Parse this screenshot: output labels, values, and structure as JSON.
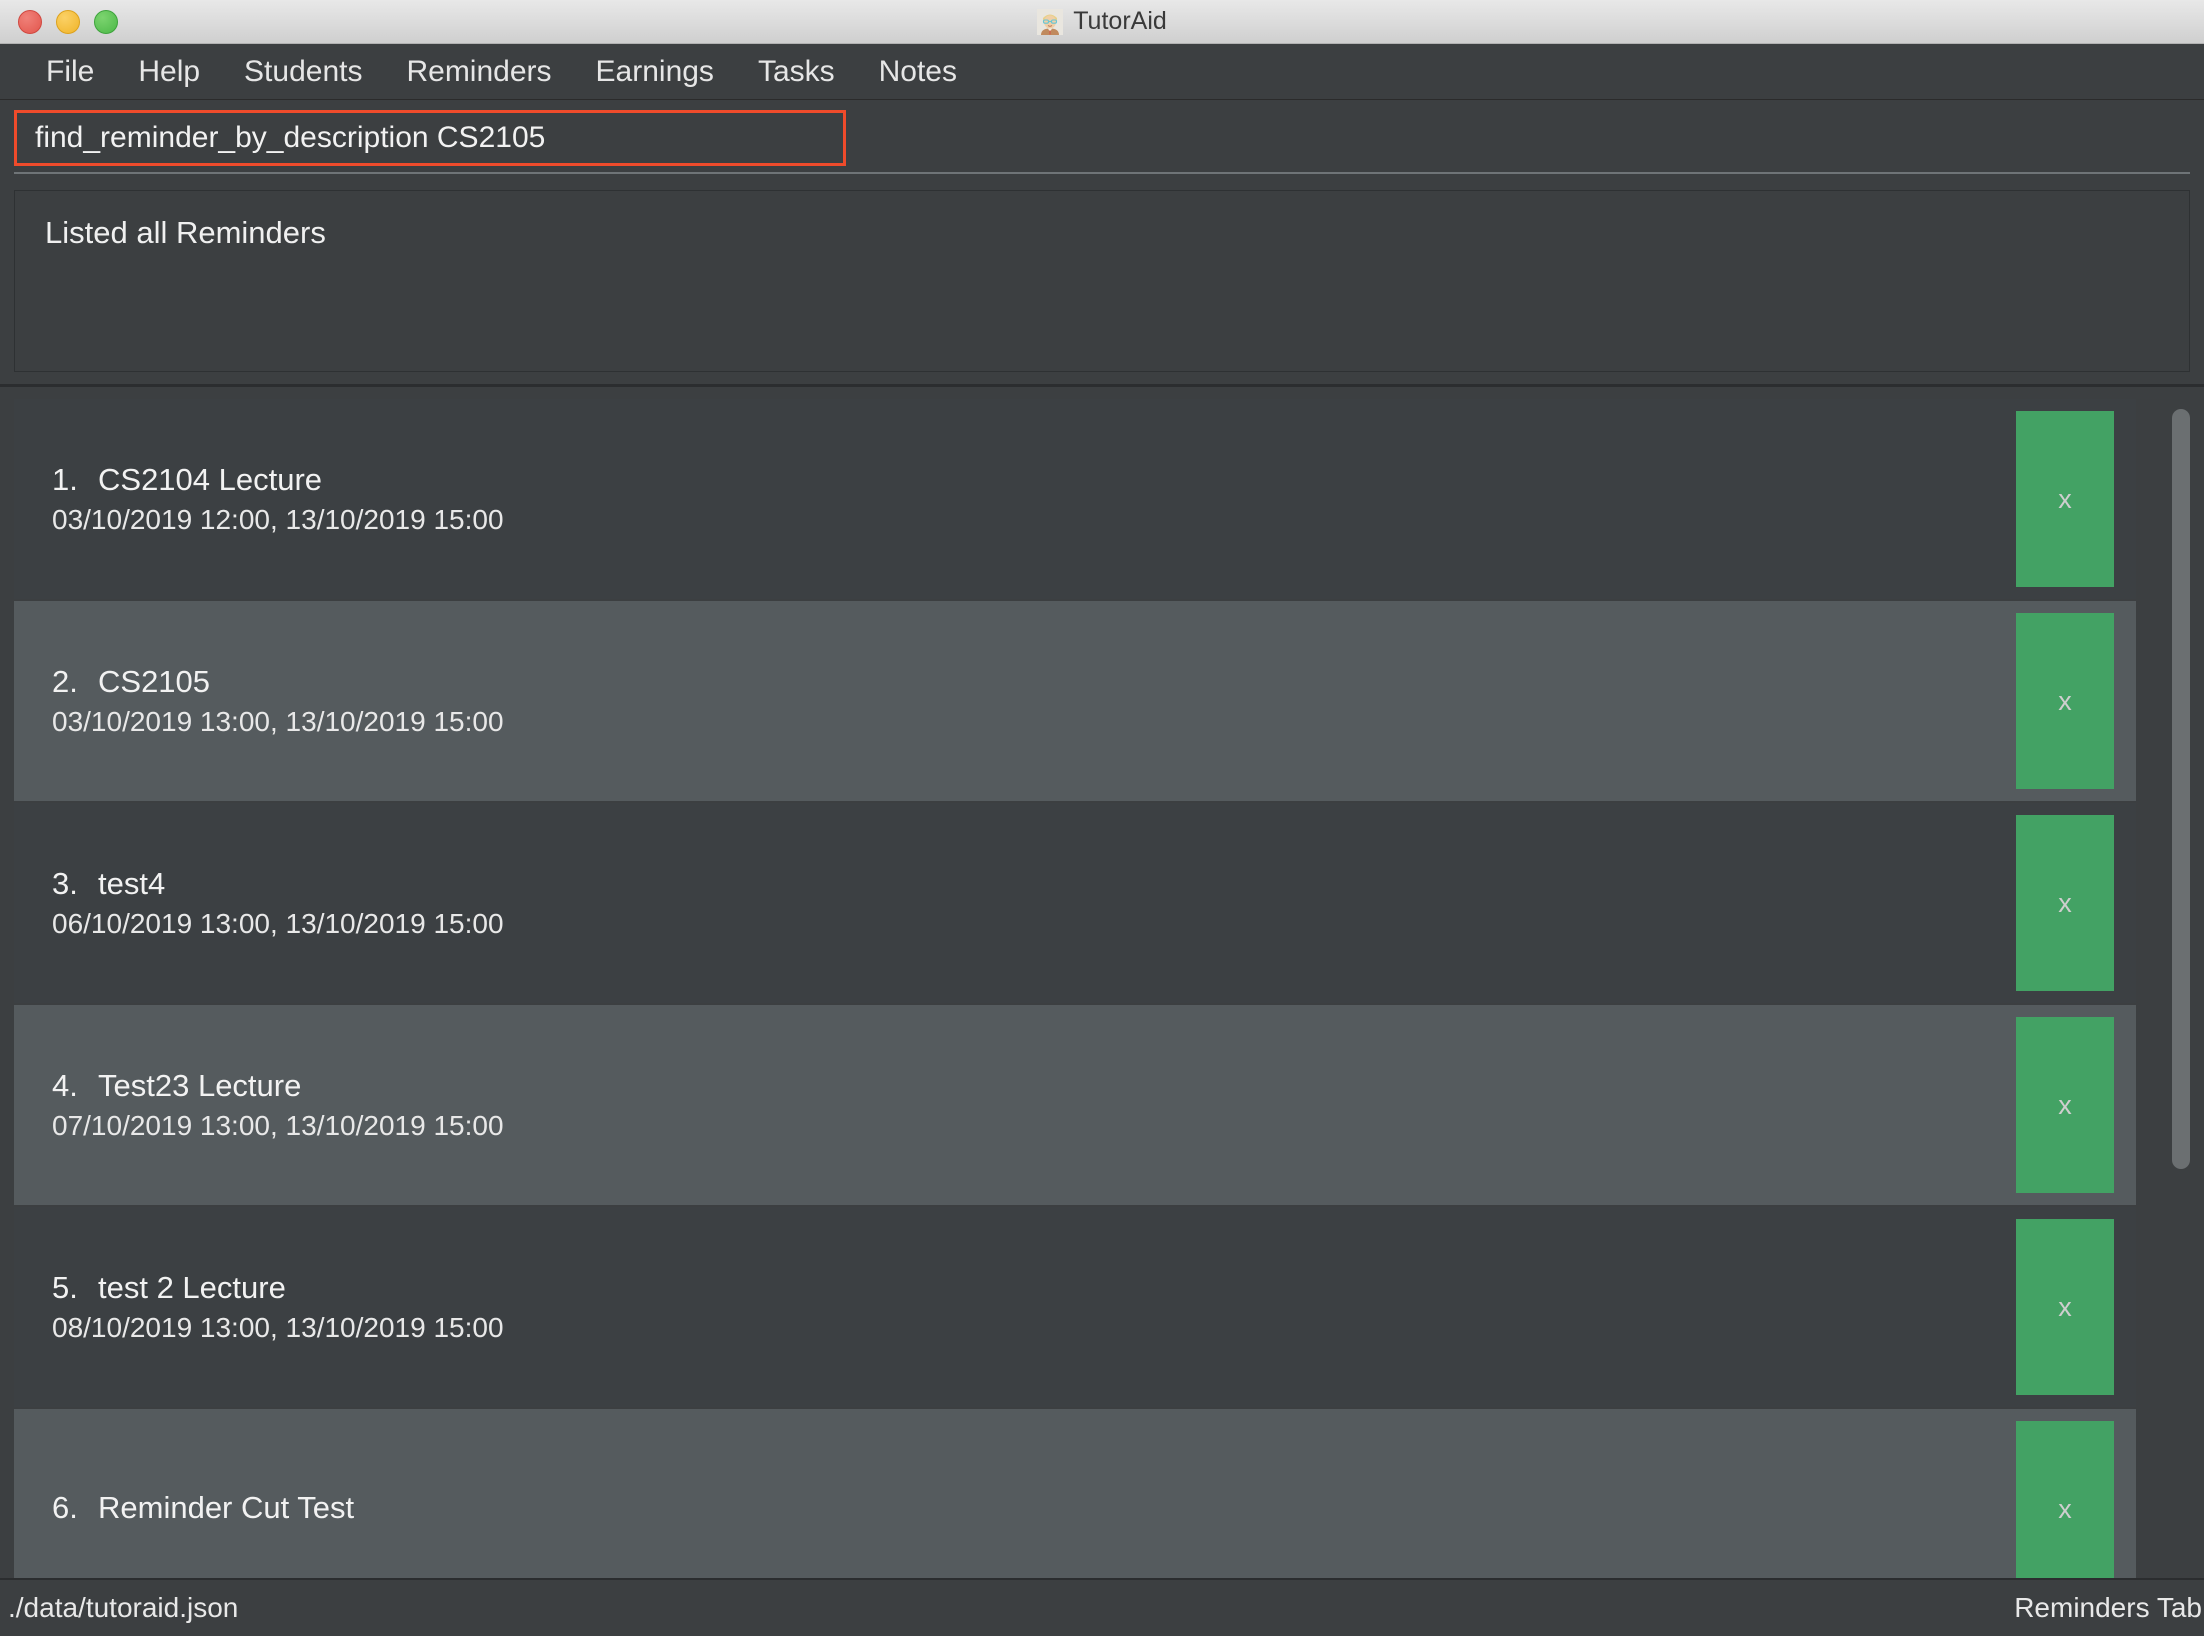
{
  "window": {
    "title": "TutorAid",
    "app_icon": "tutor-avatar-icon",
    "traffic_lights": [
      {
        "name": "close",
        "color": "#e2564d"
      },
      {
        "name": "minimize",
        "color": "#f0b429"
      },
      {
        "name": "zoom",
        "color": "#4cb848"
      }
    ]
  },
  "menubar": {
    "items": [
      {
        "label": "File"
      },
      {
        "label": "Help"
      },
      {
        "label": "Students"
      },
      {
        "label": "Reminders"
      },
      {
        "label": "Earnings"
      },
      {
        "label": "Tasks"
      },
      {
        "label": "Notes"
      }
    ]
  },
  "command": {
    "value": "find_reminder_by_description CS2105",
    "placeholder": "Enter command here...",
    "highlight_color": "#ef4b2b"
  },
  "result": {
    "text": "Listed all Reminders"
  },
  "list": {
    "delete_button_label": "x",
    "delete_button_color": "#43a264",
    "items": [
      {
        "index": "1.",
        "title": "CS2104 Lecture",
        "datetime": "03/10/2019 12:00, 13/10/2019 15:00"
      },
      {
        "index": "2.",
        "title": "CS2105",
        "datetime": "03/10/2019 13:00, 13/10/2019 15:00"
      },
      {
        "index": "3.",
        "title": "test4",
        "datetime": "06/10/2019 13:00, 13/10/2019 15:00"
      },
      {
        "index": "4.",
        "title": "Test23 Lecture",
        "datetime": "07/10/2019 13:00, 13/10/2019 15:00"
      },
      {
        "index": "5.",
        "title": "test 2 Lecture",
        "datetime": "08/10/2019 13:00, 13/10/2019 15:00"
      },
      {
        "index": "6.",
        "title": "Reminder Cut Test",
        "datetime": ""
      }
    ]
  },
  "statusbar": {
    "file_path": "./data/tutoraid.json",
    "tab_label": "Reminders Tab"
  }
}
